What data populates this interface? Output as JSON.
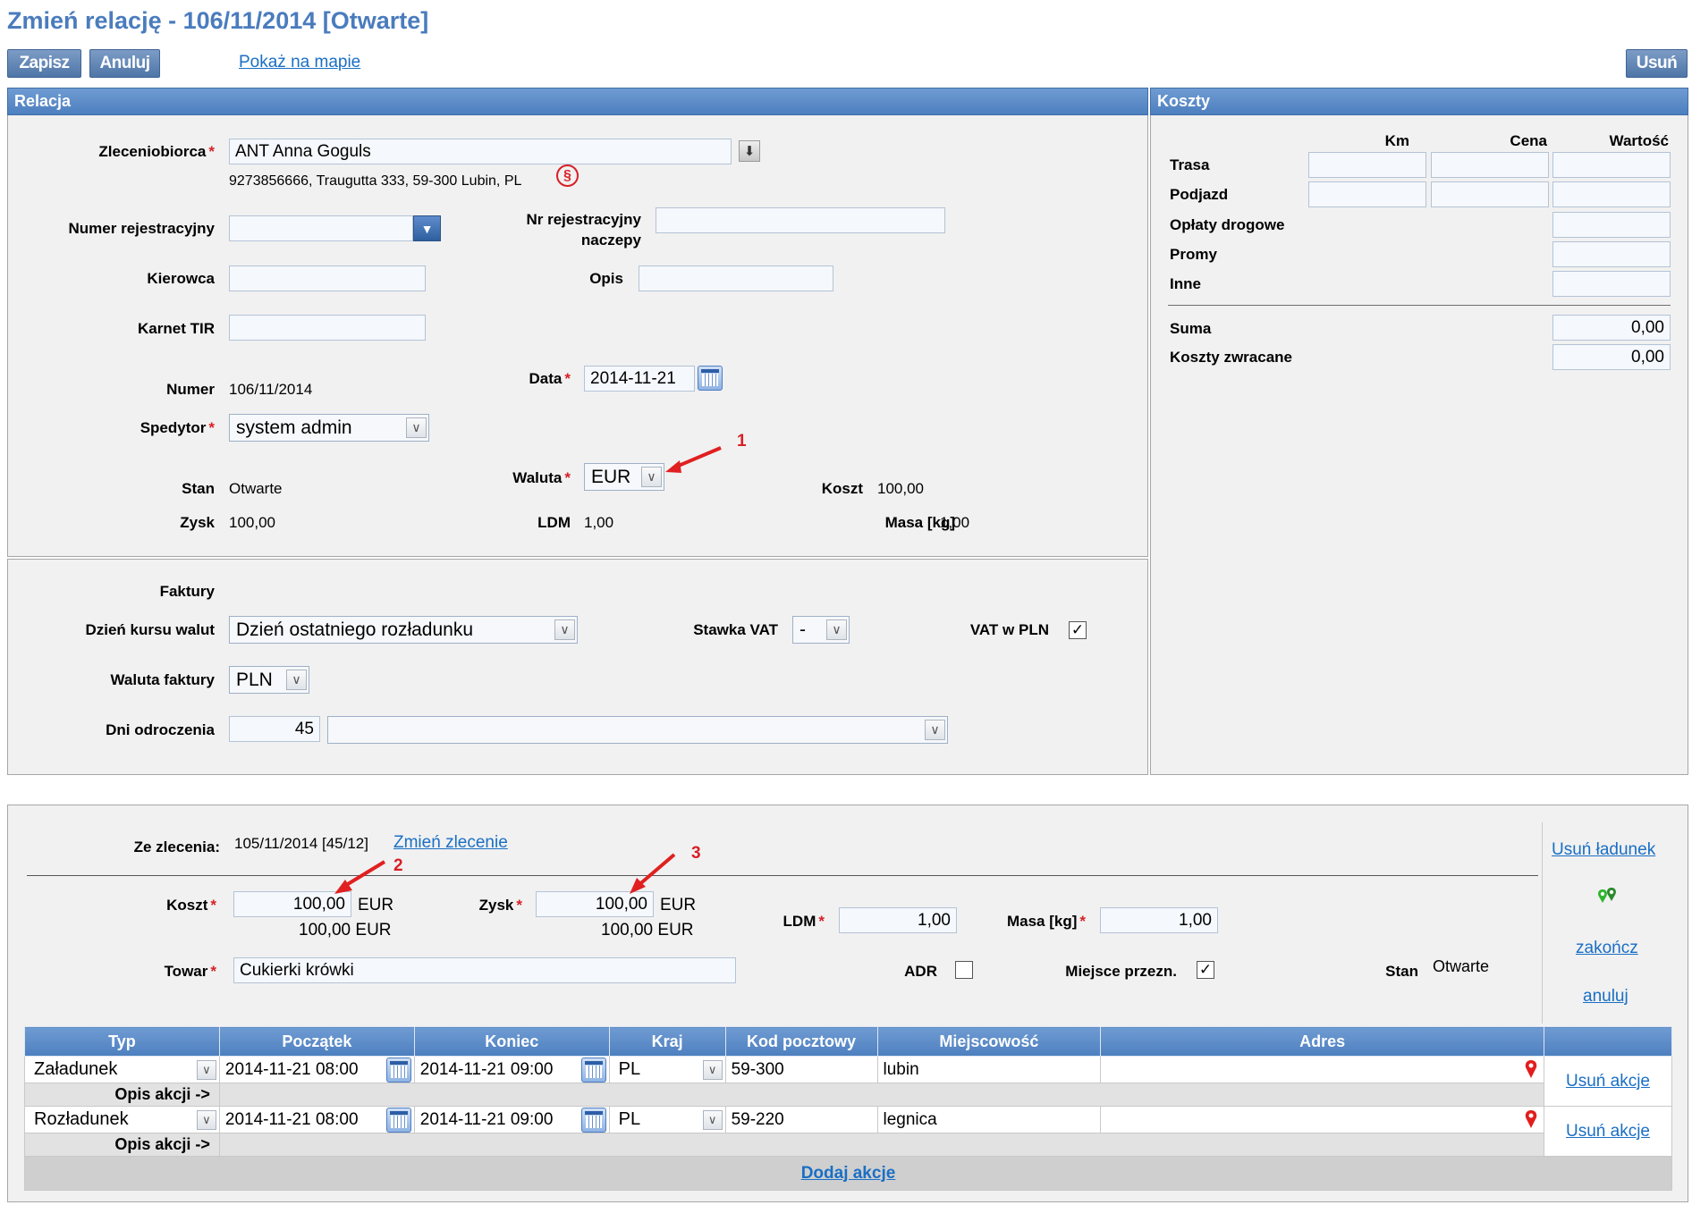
{
  "page": {
    "title": "Zmień relację - 106/11/2014 [Otwarte]"
  },
  "toolbar": {
    "save_label": "Zapisz",
    "cancel_label": "Anuluj",
    "map_link": "Pokaż na mapie",
    "delete_label": "Usuń"
  },
  "relacja": {
    "header": "Relacja",
    "zleceniobiorca_label": "Zleceniobiorca",
    "zleceniobiorca_value": "ANT Anna Goguls",
    "zleceniobiorca_address": "9273856666, Traugutta 333, 59-300 Lubin, PL",
    "paragraph_icon": "§",
    "numer_rej_label": "Numer rejestracyjny",
    "numer_rej_value": "",
    "nr_rej_naczepy_label_1": "Nr rejestracyjny",
    "nr_rej_naczepy_label_2": "naczepy",
    "nr_rej_naczepy_value": "",
    "kierowca_label": "Kierowca",
    "kierowca_value": "",
    "opis_label": "Opis",
    "opis_value": "",
    "karnet_label": "Karnet TIR",
    "karnet_value": "",
    "numer_label": "Numer",
    "numer_value": "106/11/2014",
    "data_label": "Data",
    "data_value": "2014-11-21",
    "spedytor_label": "Spedytor",
    "spedytor_value": "system admin",
    "waluta_label": "Waluta",
    "waluta_value": "EUR",
    "stan_label": "Stan",
    "stan_value": "Otwarte",
    "koszt_label": "Koszt",
    "koszt_value": "100,00",
    "zysk_label": "Zysk",
    "zysk_value": "100,00",
    "ldm_label": "LDM",
    "ldm_value": "1,00",
    "masa_label": "Masa [kg]",
    "masa_value": "1,00"
  },
  "faktury": {
    "header": "Faktury",
    "dzien_kursu_label": "Dzień kursu walut",
    "dzien_kursu_value": "Dzień ostatniego rozładunku",
    "stawka_vat_label": "Stawka VAT",
    "stawka_vat_value": "-",
    "vat_pln_label": "VAT w PLN",
    "vat_pln_checked": "✓",
    "waluta_faktury_label": "Waluta faktury",
    "waluta_faktury_value": "PLN",
    "dni_odroczenia_label": "Dni odroczenia",
    "dni_odroczenia_value": "45",
    "dni_odroczenia_select": ""
  },
  "koszty": {
    "header": "Koszty",
    "col_km": "Km",
    "col_cena": "Cena",
    "col_wartosc": "Wartość",
    "rows": [
      "Trasa",
      "Podjazd",
      "Opłaty drogowe",
      "Promy",
      "Inne"
    ],
    "suma_label": "Suma",
    "suma_value": "0,00",
    "zwracane_label": "Koszty zwracane",
    "zwracane_value": "0,00"
  },
  "ladunek": {
    "ze_zlecenia_label": "Ze zlecenia:",
    "ze_zlecenia_value": "105/11/2014 [45/12]",
    "zmien_zlecenie": "Zmień zlecenie",
    "usun_ladunek": "Usuń ładunek",
    "zakoncz": "zakończ",
    "anuluj": "anuluj",
    "koszt_label": "Koszt",
    "koszt_value": "100,00",
    "koszt_currency": "EUR",
    "koszt_converted": "100,00 EUR",
    "zysk_label": "Zysk",
    "zysk_value": "100,00",
    "zysk_currency": "EUR",
    "zysk_converted": "100,00 EUR",
    "ldm_label": "LDM",
    "ldm_value": "1,00",
    "masa_label": "Masa [kg]",
    "masa_value": "1,00",
    "towar_label": "Towar",
    "towar_value": "Cukierki krówki",
    "adr_label": "ADR",
    "miejsce_label": "Miejsce przezn.",
    "miejsce_checked": "✓",
    "stan_label": "Stan",
    "stan_value": "Otwarte"
  },
  "annotations": {
    "n1": "1",
    "n2": "2",
    "n3": "3"
  },
  "actions_table": {
    "headers": [
      "Typ",
      "Początek",
      "Koniec",
      "Kraj",
      "Kod pocztowy",
      "Miejscowość",
      "Adres"
    ],
    "rows": [
      {
        "typ": "Załadunek",
        "start": "2014-11-21 08:00",
        "end": "2014-11-21 09:00",
        "kraj": "PL",
        "kod": "59-300",
        "miejscowosc": "lubin",
        "adres": "",
        "opis": "Opis akcji ->",
        "remove": "Usuń akcje"
      },
      {
        "typ": "Rozładunek",
        "start": "2014-11-21 08:00",
        "end": "2014-11-21 09:00",
        "kraj": "PL",
        "kod": "59-220",
        "miejscowosc": "legnica",
        "adres": "",
        "opis": "Opis akcji ->",
        "remove": "Usuń akcje"
      }
    ],
    "add_action": "Dodaj akcje"
  }
}
